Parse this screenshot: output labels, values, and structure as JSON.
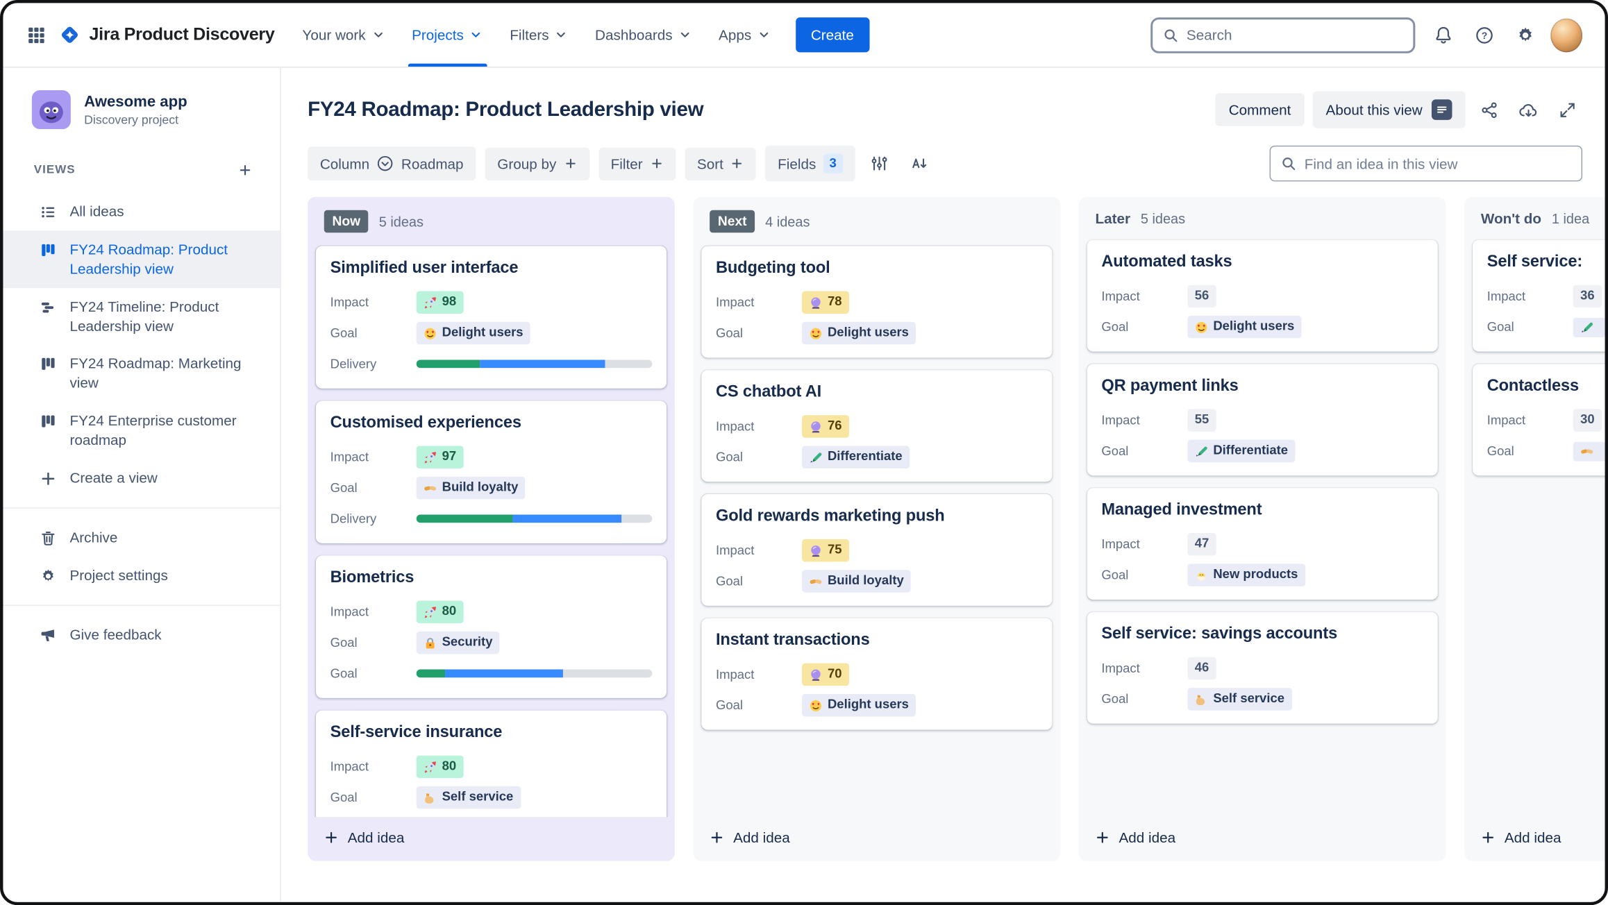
{
  "colors": {
    "accent_blue": "#0C66E4",
    "now_column_bg": "#ECE9FA",
    "column_bg": "#F7F8F9",
    "status_chip_bg": "#596773",
    "impact_green_bg": "#BAF3DB",
    "impact_yellow_bg": "#F8E6A0",
    "impact_gray_bg": "#EFF1F4",
    "goal_chip_bg": "#E9EBF7",
    "progress_green": "#22A06B",
    "progress_blue": "#388BFF"
  },
  "topnav": {
    "brand": "Jira Product Discovery",
    "items": [
      {
        "label": "Your work"
      },
      {
        "label": "Projects"
      },
      {
        "label": "Filters"
      },
      {
        "label": "Dashbo​ards"
      },
      {
        "label": "Apps"
      }
    ],
    "create_label": "Create",
    "search_placeholder": "Search"
  },
  "sidebar": {
    "project_name": "Awesome app",
    "project_type": "Discovery project",
    "views_label": "VIEWS",
    "views": [
      {
        "label": "All ideas"
      },
      {
        "label": "FY24 Roadmap: Product Leadership view"
      },
      {
        "label": "FY24 Timeline: Product Leadership view"
      },
      {
        "label": "FY24 Roadmap: Marketing view"
      },
      {
        "label": "FY24 Enterprise customer roadmap"
      }
    ],
    "create_view_label": "Create a view",
    "archive_label": "Archive",
    "settings_label": "Project settings",
    "feedback_label": "Give feedback"
  },
  "header": {
    "title": "FY24 Roadmap: Product Leadership view",
    "comment_label": "Comment",
    "about_label": "About this view"
  },
  "toolbar": {
    "column_label": "Column",
    "column_value": "Roadmap",
    "groupby_label": "Group by",
    "filter_label": "Filter",
    "sort_label": "Sort",
    "fields_label": "Fields",
    "fields_count": "3",
    "find_placeholder": "Find an idea in this view"
  },
  "board": {
    "add_idea_label": "Add idea",
    "columns": [
      {
        "status": "Now",
        "count": "5 ideas",
        "cards": [
          {
            "title": "Simplified user interface",
            "rows": [
              {
                "label": "Impact",
                "badge": {
                  "icon": "rocket-icon",
                  "text": "98"
                }
              },
              {
                "label": "Goal",
                "badge": {
                  "icon": "heart-eyes-icon",
                  "text": "Delight users"
                }
              },
              {
                "label": "Delivery",
                "progress": {
                  "green_pct": 27,
                  "blue_pct": 53
                }
              }
            ]
          },
          {
            "title": "Customised experiences",
            "rows": [
              {
                "label": "Impact",
                "badge": {
                  "icon": "rocket-icon",
                  "text": "97"
                }
              },
              {
                "label": "Goal",
                "badge": {
                  "icon": "handshake-icon",
                  "text": "Build loyalty"
                }
              },
              {
                "label": "Delivery",
                "progress": {
                  "green_pct": 41,
                  "blue_pct": 46
                }
              }
            ]
          },
          {
            "title": "Biometrics",
            "rows": [
              {
                "label": "Impact",
                "badge": {
                  "icon": "rocket-icon",
                  "text": "80"
                }
              },
              {
                "label": "Goal",
                "badge": {
                  "icon": "lock-icon",
                  "text": "Security"
                }
              },
              {
                "label": "Goal",
                "progress": {
                  "green_pct": 12,
                  "blue_pct": 50
                }
              }
            ]
          },
          {
            "title": "Self-service insurance",
            "rows": [
              {
                "label": "Impact",
                "badge": {
                  "icon": "rocket-icon",
                  "text": "80"
                }
              },
              {
                "label": "Goal",
                "badge": {
                  "icon": "flex-arm-icon",
                  "text": "Self service"
                }
              }
            ]
          }
        ]
      },
      {
        "status": "Next",
        "count": "4 ideas",
        "cards": [
          {
            "title": "Budgeting tool",
            "rows": [
              {
                "label": "Impact",
                "badge": {
                  "icon": "crystal-ball-icon",
                  "text": "78"
                }
              },
              {
                "label": "Goal",
                "badge": {
                  "icon": "heart-eyes-icon",
                  "text": "Delight users"
                }
              }
            ]
          },
          {
            "title": "CS chatbot AI",
            "rows": [
              {
                "label": "Impact",
                "badge": {
                  "icon": "crystal-ball-icon",
                  "text": "76"
                }
              },
              {
                "label": "Goal",
                "badge": {
                  "icon": "pen-icon",
                  "text": "Differentiate"
                }
              }
            ]
          },
          {
            "title": "Gold rewards marketing push",
            "rows": [
              {
                "label": "Impact",
                "badge": {
                  "icon": "crystal-ball-icon",
                  "text": "75"
                }
              },
              {
                "label": "Goal",
                "badge": {
                  "icon": "handshake-icon",
                  "text": "Build loyalty"
                }
              }
            ]
          },
          {
            "title": "Instant transactions",
            "rows": [
              {
                "label": "Impact",
                "badge": {
                  "icon": "crystal-ball-icon",
                  "text": "70"
                }
              },
              {
                "label": "Goal",
                "badge": {
                  "icon": "heart-eyes-icon",
                  "text": "Delight users"
                }
              }
            ]
          }
        ]
      },
      {
        "status": "Later",
        "count": "5 ideas",
        "cards": [
          {
            "title": "Automated tasks",
            "rows": [
              {
                "label": "Impact",
                "badge": {
                  "text": "56"
                }
              },
              {
                "label": "Goal",
                "badge": {
                  "icon": "heart-eyes-icon",
                  "text": "Delight users"
                }
              }
            ]
          },
          {
            "title": "QR payment links",
            "rows": [
              {
                "label": "Impact",
                "badge": {
                  "text": "55"
                }
              },
              {
                "label": "Goal",
                "badge": {
                  "icon": "pen-icon",
                  "text": "Differentiate"
                }
              }
            ]
          },
          {
            "title": "Managed investment",
            "rows": [
              {
                "label": "Impact",
                "badge": {
                  "text": "47"
                }
              },
              {
                "label": "Goal",
                "badge": {
                  "icon": "hatching-chick-icon",
                  "text": "New products"
                }
              }
            ]
          },
          {
            "title": "Self service: savings accounts",
            "rows": [
              {
                "label": "Impact",
                "badge": {
                  "text": "46"
                }
              },
              {
                "label": "Goal",
                "badge": {
                  "icon": "flex-arm-icon",
                  "text": "Self service"
                }
              }
            ]
          }
        ]
      },
      {
        "status": "Won't do",
        "count": "1 idea",
        "cards": [
          {
            "title": "Self service:",
            "rows": [
              {
                "label": "Impact",
                "badge": {
                  "text": "36"
                }
              },
              {
                "label": "Goal",
                "badge": {
                  "icon": "pen-icon",
                  "text": ""
                }
              }
            ]
          },
          {
            "title": "Contactless",
            "rows": [
              {
                "label": "Impact",
                "badge": {
                  "text": "30"
                }
              },
              {
                "label": "Goal",
                "badge": {
                  "icon": "handshake-icon",
                  "text": ""
                }
              }
            ]
          }
        ]
      }
    ]
  }
}
